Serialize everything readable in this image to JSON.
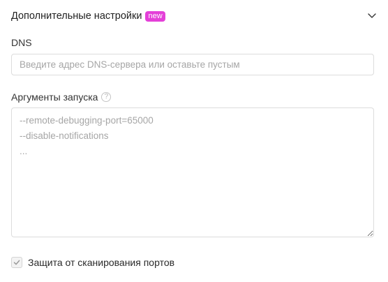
{
  "section": {
    "title": "Дополнительные настройки",
    "badge": "new",
    "chevron_icon": "chevron-down-icon"
  },
  "dns": {
    "label": "DNS",
    "placeholder": "Введите адрес DNS-сервера или оставьте пустым",
    "value": ""
  },
  "launch_args": {
    "label": "Аргументы запуска",
    "help_icon": "help-circle-icon",
    "help_glyph": "?",
    "placeholder": "--remote-debugging-port=65000\n--disable-notifications\n...",
    "value": ""
  },
  "port_scan_protection": {
    "label": "Защита от сканирования портов",
    "checked": true,
    "check_icon": "check-icon"
  },
  "colors": {
    "badge": "#e440d8",
    "border": "#dcdcdc",
    "placeholder": "#a6a6a6"
  }
}
